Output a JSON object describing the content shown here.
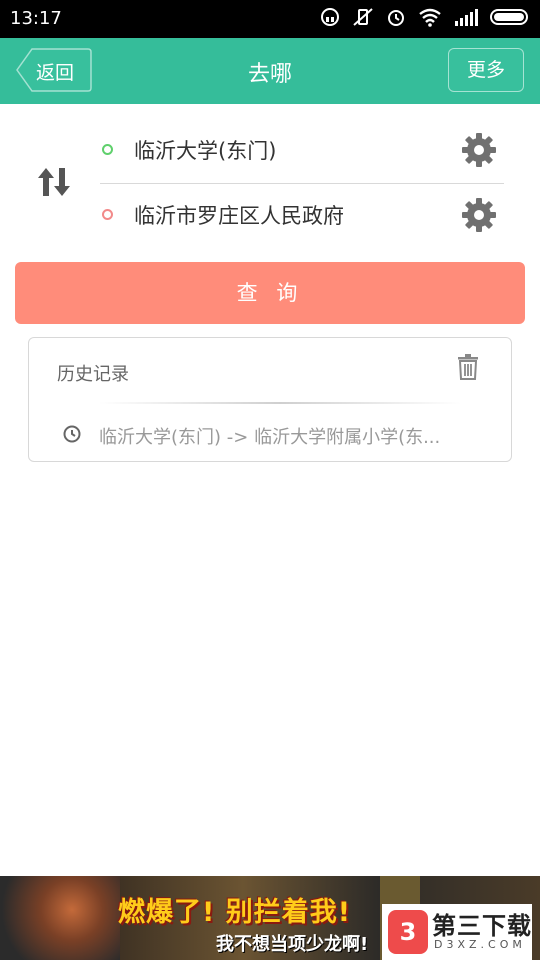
{
  "status_bar": {
    "time": "13:17"
  },
  "header": {
    "title": "去哪",
    "back_label": "返回",
    "more_label": "更多"
  },
  "route": {
    "origin": "临沂大学(东门)",
    "destination": "临沂市罗庄区人民政府"
  },
  "query_button": {
    "label": "查 询"
  },
  "history": {
    "title": "历史记录",
    "items": [
      {
        "text": "临沂大学(东门) -> 临沂大学附属小学(东..."
      }
    ]
  },
  "ad": {
    "headline": "燃爆了! 别拦着我!",
    "subline": "我不想当项少龙啊!"
  },
  "watermark": {
    "brand": "第三下载",
    "domain": "D3XZ.COM"
  },
  "colors": {
    "header": "#35bd9a",
    "query_button": "#ff8c7a",
    "origin_dot": "#5fd06c",
    "destination_dot": "#f28a8a"
  },
  "icons": [
    "swap-vertical-icon",
    "gear-icon",
    "trash-icon",
    "clock-icon",
    "back-arrow-icon"
  ]
}
